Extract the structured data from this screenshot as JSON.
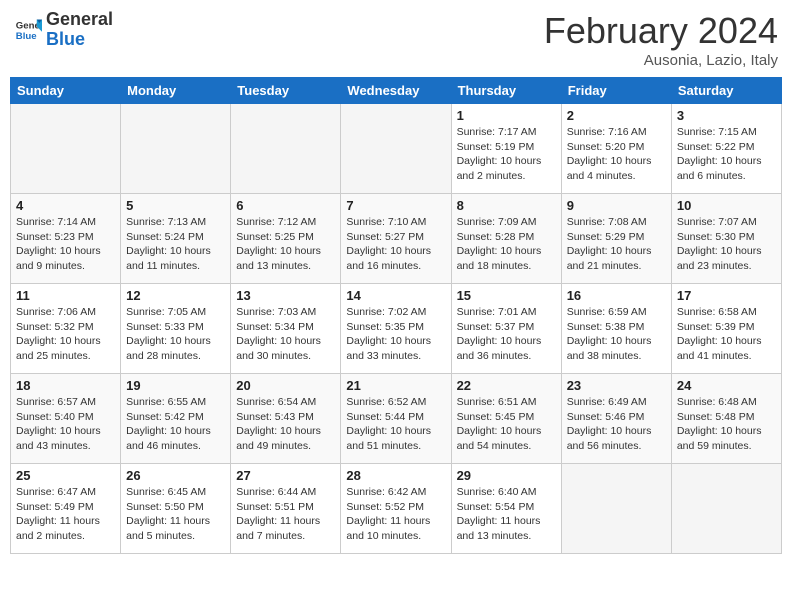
{
  "header": {
    "logo_line1": "General",
    "logo_line2": "Blue",
    "month_title": "February 2024",
    "subtitle": "Ausonia, Lazio, Italy"
  },
  "weekdays": [
    "Sunday",
    "Monday",
    "Tuesday",
    "Wednesday",
    "Thursday",
    "Friday",
    "Saturday"
  ],
  "weeks": [
    [
      {
        "day": "",
        "empty": true
      },
      {
        "day": "",
        "empty": true
      },
      {
        "day": "",
        "empty": true
      },
      {
        "day": "",
        "empty": true
      },
      {
        "day": "1",
        "sunrise": "7:17 AM",
        "sunset": "5:19 PM",
        "daylight": "10 hours and 2 minutes."
      },
      {
        "day": "2",
        "sunrise": "7:16 AM",
        "sunset": "5:20 PM",
        "daylight": "10 hours and 4 minutes."
      },
      {
        "day": "3",
        "sunrise": "7:15 AM",
        "sunset": "5:22 PM",
        "daylight": "10 hours and 6 minutes."
      }
    ],
    [
      {
        "day": "4",
        "sunrise": "7:14 AM",
        "sunset": "5:23 PM",
        "daylight": "10 hours and 9 minutes."
      },
      {
        "day": "5",
        "sunrise": "7:13 AM",
        "sunset": "5:24 PM",
        "daylight": "10 hours and 11 minutes."
      },
      {
        "day": "6",
        "sunrise": "7:12 AM",
        "sunset": "5:25 PM",
        "daylight": "10 hours and 13 minutes."
      },
      {
        "day": "7",
        "sunrise": "7:10 AM",
        "sunset": "5:27 PM",
        "daylight": "10 hours and 16 minutes."
      },
      {
        "day": "8",
        "sunrise": "7:09 AM",
        "sunset": "5:28 PM",
        "daylight": "10 hours and 18 minutes."
      },
      {
        "day": "9",
        "sunrise": "7:08 AM",
        "sunset": "5:29 PM",
        "daylight": "10 hours and 21 minutes."
      },
      {
        "day": "10",
        "sunrise": "7:07 AM",
        "sunset": "5:30 PM",
        "daylight": "10 hours and 23 minutes."
      }
    ],
    [
      {
        "day": "11",
        "sunrise": "7:06 AM",
        "sunset": "5:32 PM",
        "daylight": "10 hours and 25 minutes."
      },
      {
        "day": "12",
        "sunrise": "7:05 AM",
        "sunset": "5:33 PM",
        "daylight": "10 hours and 28 minutes."
      },
      {
        "day": "13",
        "sunrise": "7:03 AM",
        "sunset": "5:34 PM",
        "daylight": "10 hours and 30 minutes."
      },
      {
        "day": "14",
        "sunrise": "7:02 AM",
        "sunset": "5:35 PM",
        "daylight": "10 hours and 33 minutes."
      },
      {
        "day": "15",
        "sunrise": "7:01 AM",
        "sunset": "5:37 PM",
        "daylight": "10 hours and 36 minutes."
      },
      {
        "day": "16",
        "sunrise": "6:59 AM",
        "sunset": "5:38 PM",
        "daylight": "10 hours and 38 minutes."
      },
      {
        "day": "17",
        "sunrise": "6:58 AM",
        "sunset": "5:39 PM",
        "daylight": "10 hours and 41 minutes."
      }
    ],
    [
      {
        "day": "18",
        "sunrise": "6:57 AM",
        "sunset": "5:40 PM",
        "daylight": "10 hours and 43 minutes."
      },
      {
        "day": "19",
        "sunrise": "6:55 AM",
        "sunset": "5:42 PM",
        "daylight": "10 hours and 46 minutes."
      },
      {
        "day": "20",
        "sunrise": "6:54 AM",
        "sunset": "5:43 PM",
        "daylight": "10 hours and 49 minutes."
      },
      {
        "day": "21",
        "sunrise": "6:52 AM",
        "sunset": "5:44 PM",
        "daylight": "10 hours and 51 minutes."
      },
      {
        "day": "22",
        "sunrise": "6:51 AM",
        "sunset": "5:45 PM",
        "daylight": "10 hours and 54 minutes."
      },
      {
        "day": "23",
        "sunrise": "6:49 AM",
        "sunset": "5:46 PM",
        "daylight": "10 hours and 56 minutes."
      },
      {
        "day": "24",
        "sunrise": "6:48 AM",
        "sunset": "5:48 PM",
        "daylight": "10 hours and 59 minutes."
      }
    ],
    [
      {
        "day": "25",
        "sunrise": "6:47 AM",
        "sunset": "5:49 PM",
        "daylight": "11 hours and 2 minutes."
      },
      {
        "day": "26",
        "sunrise": "6:45 AM",
        "sunset": "5:50 PM",
        "daylight": "11 hours and 5 minutes."
      },
      {
        "day": "27",
        "sunrise": "6:44 AM",
        "sunset": "5:51 PM",
        "daylight": "11 hours and 7 minutes."
      },
      {
        "day": "28",
        "sunrise": "6:42 AM",
        "sunset": "5:52 PM",
        "daylight": "11 hours and 10 minutes."
      },
      {
        "day": "29",
        "sunrise": "6:40 AM",
        "sunset": "5:54 PM",
        "daylight": "11 hours and 13 minutes."
      },
      {
        "day": "",
        "empty": true
      },
      {
        "day": "",
        "empty": true
      }
    ]
  ]
}
